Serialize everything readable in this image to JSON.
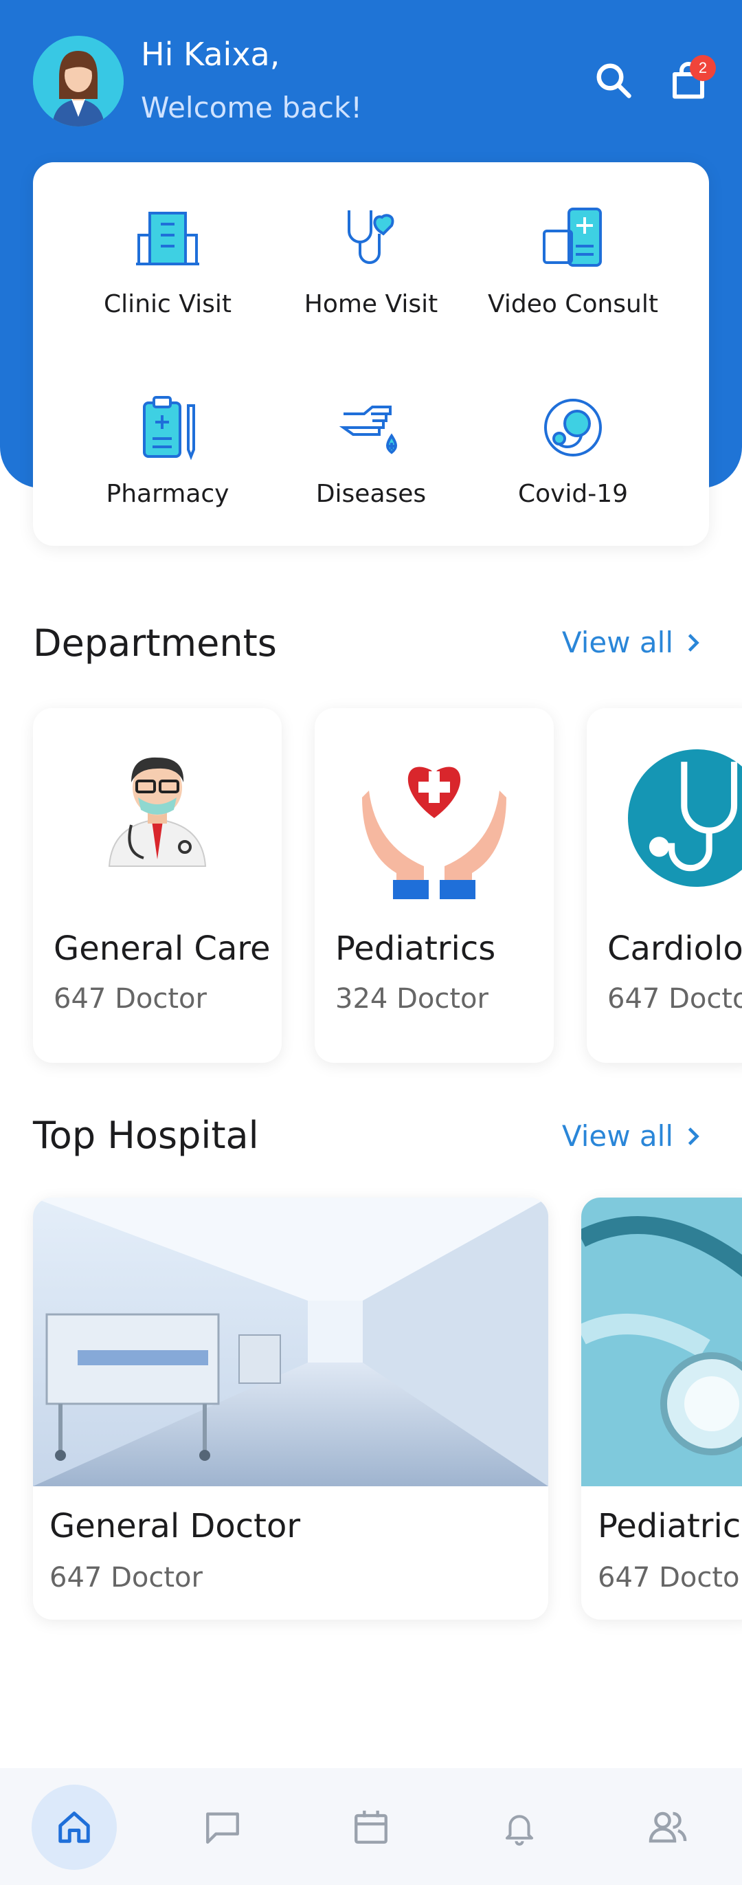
{
  "header": {
    "greeting": "Hi Kaixa,",
    "subtitle": "Welcome back!",
    "cart_badge": "2"
  },
  "services": [
    {
      "label": "Clinic Visit",
      "icon": "clinic-icon"
    },
    {
      "label": "Home Visit",
      "icon": "stethoscope-heart-icon"
    },
    {
      "label": "Video Consult",
      "icon": "video-consult-icon"
    },
    {
      "label": "Pharmacy",
      "icon": "clipboard-icon"
    },
    {
      "label": "Diseases",
      "icon": "hand-drop-icon"
    },
    {
      "label": "Covid-19",
      "icon": "virus-icon"
    }
  ],
  "departments": {
    "title": "Departments",
    "view_all": "View all",
    "items": [
      {
        "name": "General Care",
        "count": "647 Doctor"
      },
      {
        "name": "Pediatrics",
        "count": "324 Doctor"
      },
      {
        "name": "Cardiolog",
        "count": "647 Docto"
      }
    ]
  },
  "hospitals": {
    "title": "Top Hospital",
    "view_all": "View all",
    "items": [
      {
        "name": "General Doctor",
        "count": "647 Doctor"
      },
      {
        "name": "Pediatrics",
        "count": "647 Docto"
      }
    ]
  },
  "nav": [
    "home-icon",
    "chat-icon",
    "calendar-icon",
    "bell-icon",
    "users-icon"
  ],
  "colors": {
    "primary": "#1f74d6",
    "accent": "#2a86d8",
    "badge": "#f0443a"
  }
}
